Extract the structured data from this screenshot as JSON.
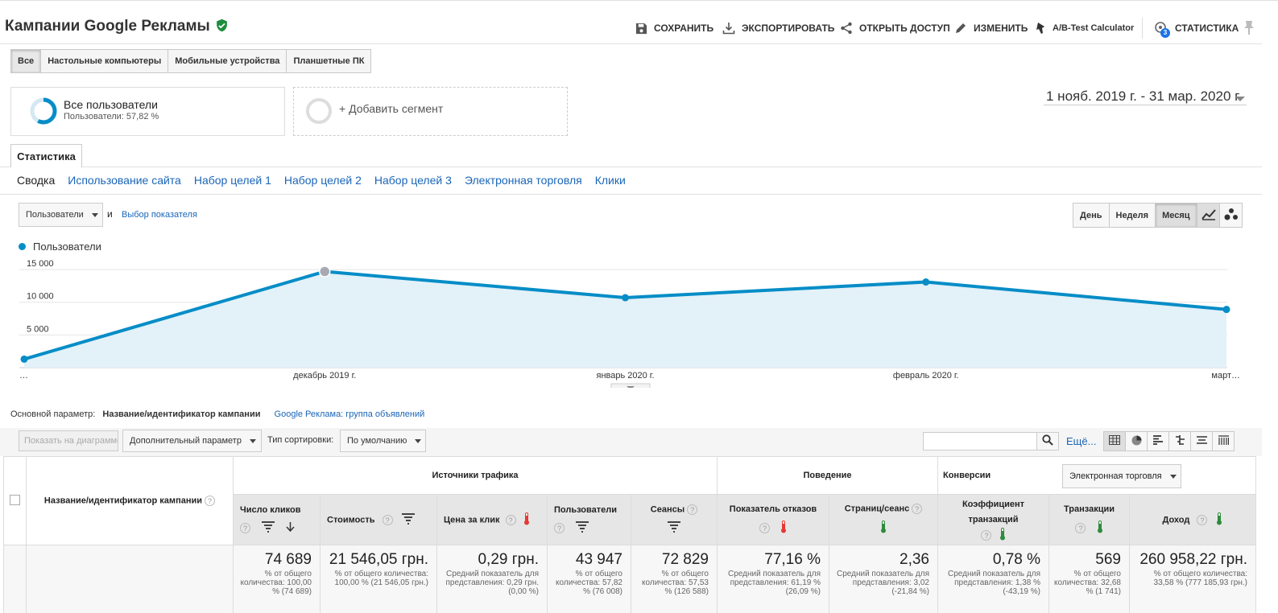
{
  "header": {
    "title": "Кампании Google Рекламы",
    "actions": {
      "save": "СОХРАНИТЬ",
      "export": "ЭКСПОРТИРОВАТЬ",
      "share": "ОТКРЫТЬ ДОСТУП",
      "edit": "ИЗМЕНИТЬ",
      "abtest": "A/B-Test Calculator",
      "insights": "СТАТИСТИКА",
      "insights_badge": "3"
    }
  },
  "device_tabs": [
    "Все",
    "Настольные компьютеры",
    "Мобильные устройства",
    "Планшетные ПК"
  ],
  "segments": {
    "active_name": "Все пользователи",
    "active_sub": "Пользователи: 57,82 %",
    "active_pct": 57.82,
    "add_label": "+ Добавить сегмент"
  },
  "date_range": "1 нояб. 2019 г. - 31 мар. 2020 г.",
  "report_tab": "Статистика",
  "subnav": [
    "Сводка",
    "Использование сайта",
    "Набор целей 1",
    "Набор целей 2",
    "Набор целей 3",
    "Электронная торговля",
    "Клики"
  ],
  "metric_picker": {
    "selected": "Пользователи",
    "and": "и",
    "choose_link": "Выбор показателя"
  },
  "period_buttons": [
    "День",
    "Неделя",
    "Месяц"
  ],
  "chart_data": {
    "type": "area",
    "series": [
      {
        "name": "Пользователи",
        "values": [
          1300,
          14700,
          10700,
          13100,
          8900
        ]
      }
    ],
    "x": [
      "…",
      "декабрь 2019 г.",
      "январь 2020 г.",
      "февраль 2020 г.",
      "март…"
    ],
    "yticks": [
      "5 000",
      "10 000",
      "15 000"
    ],
    "ylim": [
      0,
      15000
    ],
    "grid": true,
    "legend": "top-left",
    "color": "#058dc7"
  },
  "dimension": {
    "label": "Основной параметр:",
    "primary": "Название/идентификатор кампании",
    "alt_link": "Google Реклама: группа объявлений"
  },
  "table_toolbar": {
    "plot_rows": "Показать на диаграмме",
    "secondary_dim": "Дополнительный параметр",
    "sort_label": "Тип сортировки:",
    "sort_value": "По умолчанию",
    "more": "Ещё..."
  },
  "table": {
    "first_col": "Название/идентификатор кампании",
    "groups": {
      "acquisition": "Источники трафика",
      "behavior": "Поведение",
      "conversions": "Конверсии",
      "conversion_select": "Электронная торговля"
    },
    "columns": [
      {
        "label": "Число кликов",
        "total": "74 689",
        "note": "% от общего количества: 100,00 % (74 689)"
      },
      {
        "label": "Стоимость",
        "total": "21 546,05 грн.",
        "note": "% от общего количества: 100,00 % (21 546,05 грн.)"
      },
      {
        "label": "Цена за клик",
        "total": "0,29 грн.",
        "note": "Средний показатель для представления: 0,29 грн. (0,00 %)"
      },
      {
        "label": "Пользователи",
        "total": "43 947",
        "note": "% от общего количества: 57,82 % (76 008)"
      },
      {
        "label": "Сеансы",
        "total": "72 829",
        "note": "% от общего количества: 57,53 % (126 588)"
      },
      {
        "label": "Показатель отказов",
        "total": "77,16 %",
        "note": "Средний показатель для представления: 61,19 % (26,09 %)"
      },
      {
        "label": "Страниц/сеанс",
        "total": "2,36",
        "note": "Средний показатель для представления: 3,02 (-21,84 %)"
      },
      {
        "label": "Коэффициент транзакций",
        "total": "0,78 %",
        "note": "Средний показатель для представления: 1,38 % (-43,19 %)"
      },
      {
        "label": "Транзакции",
        "total": "569",
        "note": "% от общего количества: 32,68 % (1 741)"
      },
      {
        "label": "Доход",
        "total": "260 958,22 грн.",
        "note": "% от общего количества: 33,58 % (777 185,93 грн.)"
      }
    ]
  },
  "colors": {
    "accent": "#058dc7",
    "link": "#1a65b8",
    "thermo_red": "#e53935",
    "thermo_green": "#2e8b3d",
    "verified": "#1e8e3e"
  }
}
